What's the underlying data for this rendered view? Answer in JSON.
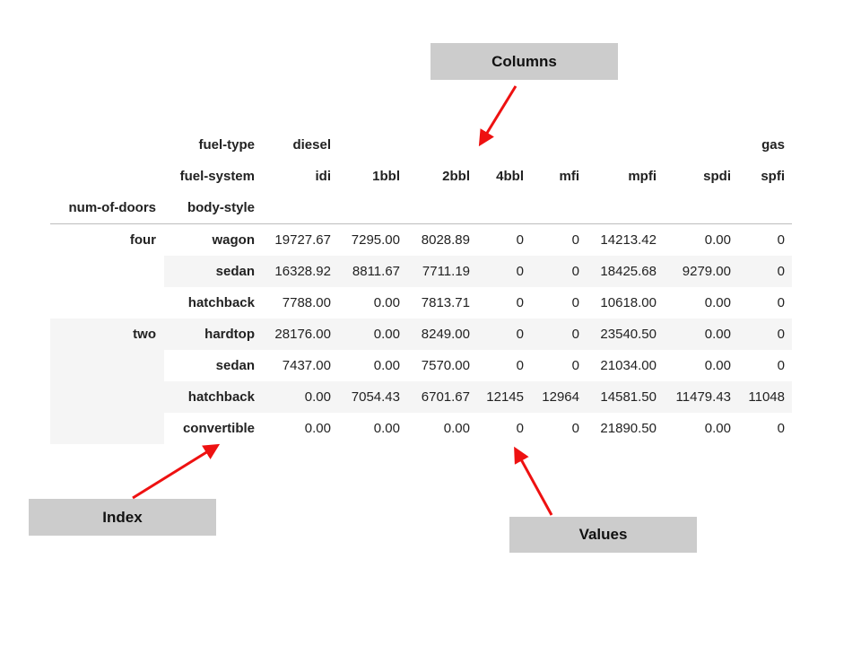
{
  "annotations": {
    "columns_label": "Columns",
    "index_label": "Index",
    "values_label": "Values",
    "arrow_color": "#ee1111",
    "box_color": "#cccccc"
  },
  "table": {
    "column_level_names": [
      "fuel-type",
      "fuel-system"
    ],
    "index_names": [
      "num-of-doors",
      "body-style"
    ],
    "fuel_type_headers": [
      {
        "label": "diesel",
        "col": 0
      },
      {
        "label": "gas",
        "col": 7
      }
    ],
    "fuel_system_headers": [
      "idi",
      "1bbl",
      "2bbl",
      "4bbl",
      "mfi",
      "mpfi",
      "spdi",
      "spfi"
    ],
    "door_groups": [
      {
        "label": "four",
        "row": 0
      },
      {
        "label": "two",
        "row": 3
      }
    ],
    "rows": [
      {
        "body_style": "wagon",
        "values": [
          "19727.67",
          "7295.00",
          "8028.89",
          "0",
          "0",
          "14213.42",
          "0.00",
          "0"
        ]
      },
      {
        "body_style": "sedan",
        "values": [
          "16328.92",
          "8811.67",
          "7711.19",
          "0",
          "0",
          "18425.68",
          "9279.00",
          "0"
        ]
      },
      {
        "body_style": "hatchback",
        "values": [
          "7788.00",
          "0.00",
          "7813.71",
          "0",
          "0",
          "10618.00",
          "0.00",
          "0"
        ]
      },
      {
        "body_style": "hardtop",
        "values": [
          "28176.00",
          "0.00",
          "8249.00",
          "0",
          "0",
          "23540.50",
          "0.00",
          "0"
        ]
      },
      {
        "body_style": "sedan",
        "values": [
          "7437.00",
          "0.00",
          "7570.00",
          "0",
          "0",
          "21034.00",
          "0.00",
          "0"
        ]
      },
      {
        "body_style": "hatchback",
        "values": [
          "0.00",
          "7054.43",
          "6701.67",
          "12145",
          "12964",
          "14581.50",
          "11479.43",
          "11048"
        ]
      },
      {
        "body_style": "convertible",
        "values": [
          "0.00",
          "0.00",
          "0.00",
          "0",
          "0",
          "21890.50",
          "0.00",
          "0"
        ]
      }
    ]
  }
}
